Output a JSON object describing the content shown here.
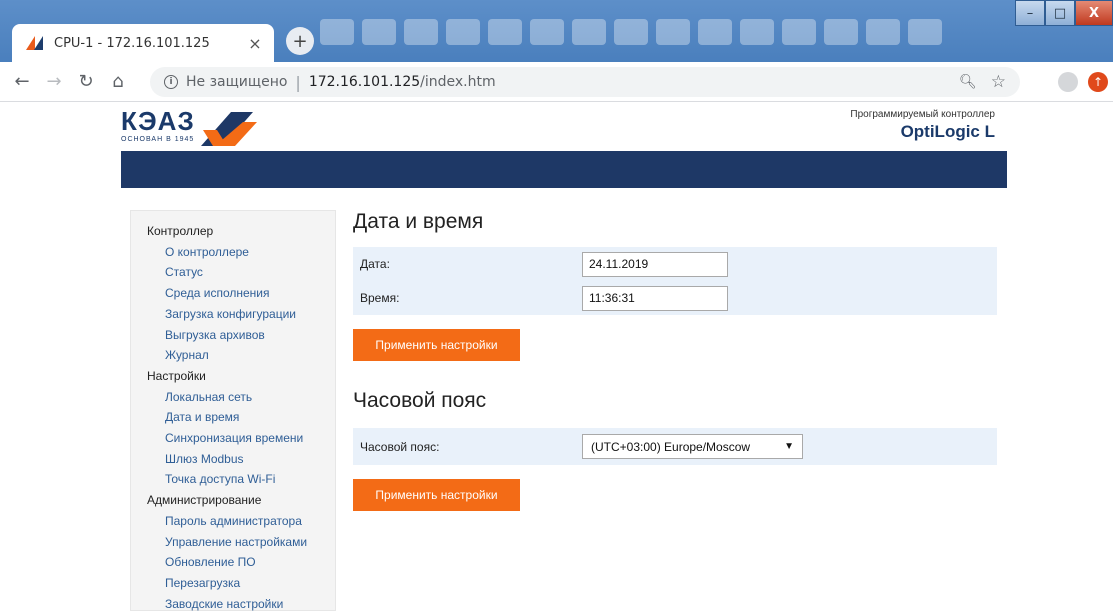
{
  "browser": {
    "tab_title": "CPU-1 - 172.16.101.125",
    "tab_close": "×",
    "new_tab": "+",
    "security_text": "Не защищено",
    "separator": "|",
    "url_host": "172.16.101.125",
    "url_path": "/index.htm",
    "window_controls": {
      "minimize": "–",
      "maximize": "□",
      "close": "X"
    }
  },
  "header": {
    "logo_text": "КЭАЗ",
    "logo_subtext": "ОСНОВАН В 1945",
    "brand_small": "Программируемый контроллер",
    "brand_big": "OptiLogic L"
  },
  "sidebar": {
    "groups": [
      {
        "label": "Контроллер",
        "items": [
          "О контроллере",
          "Статус",
          "Среда исполнения",
          "Загрузка конфигурации",
          "Выгрузка архивов",
          "Журнал"
        ]
      },
      {
        "label": "Настройки",
        "items": [
          "Локальная сеть",
          "Дата и время",
          "Синхронизация времени",
          "Шлюз Modbus",
          "Точка доступа Wi-Fi"
        ]
      },
      {
        "label": "Администрирование",
        "items": [
          "Пароль администратора",
          "Управление настройками",
          "Обновление ПО",
          "Перезагрузка",
          "Заводские настройки"
        ]
      }
    ]
  },
  "datetime": {
    "heading": "Дата и время",
    "date_label": "Дата:",
    "date_value": "24.11.2019",
    "time_label": "Время:",
    "time_value": "11:36:31",
    "apply_button": "Применить настройки"
  },
  "timezone": {
    "heading": "Часовой пояс",
    "label": "Часовой пояс:",
    "selected": "(UTC+03:00) Europe/Moscow",
    "apply_button": "Применить настройки"
  },
  "colors": {
    "brand_blue": "#1e3866",
    "brand_orange": "#f36b16",
    "link_blue": "#2f5e96",
    "form_bg": "#e9f1fa"
  }
}
